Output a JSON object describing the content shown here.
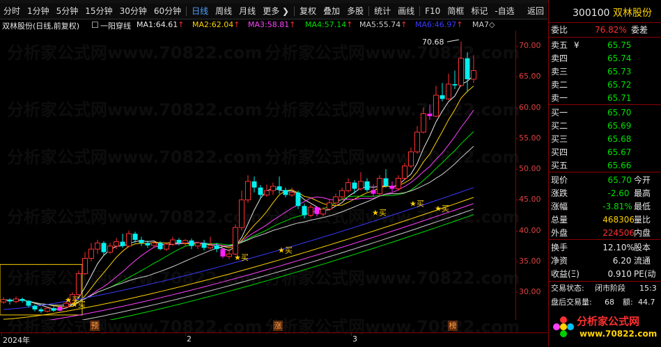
{
  "toolbar": {
    "items": [
      "分时",
      "1分钟",
      "5分钟",
      "15分钟",
      "30分钟",
      "60分钟",
      "日线",
      "周线",
      "月线",
      "更多 ❯",
      "复权",
      "叠加",
      "多股",
      "统计",
      "画线",
      "F10",
      "简框",
      "标记",
      "-自选"
    ],
    "active_index": 6,
    "back_label": "返回"
  },
  "header": {
    "stock": "双林股份",
    "mode": "(日线,前复权)",
    "indicator": "一阳穿线",
    "ma": [
      {
        "label": "MA1:",
        "value": "64.61",
        "color": "#e8e8e8"
      },
      {
        "label": "MA2:",
        "value": "62.04",
        "color": "#ffd200"
      },
      {
        "label": "MA3:",
        "value": "58.81",
        "color": "#ff40ff"
      },
      {
        "label": "MA4:",
        "value": "57.14",
        "color": "#00e000"
      },
      {
        "label": "MA5:",
        "value": "55.74",
        "color": "#cccccc"
      },
      {
        "label": "MA6:",
        "value": "46.97",
        "color": "#3a3aff"
      },
      {
        "label": "MA7",
        "value": "",
        "color": "#cccccc"
      }
    ],
    "arrow": "↑",
    "more_icon": "◇"
  },
  "chart_data": {
    "type": "candlestick",
    "y_ticks": [
      "70.00",
      "65.00",
      "60.00",
      "55.00",
      "50.00",
      "45.00",
      "40.00",
      "35.00",
      "30.00"
    ],
    "ylim": [
      25.5,
      72.5
    ],
    "x_labels": [
      "2024年",
      "2",
      "3"
    ],
    "peak_label": "70.68",
    "buy_label": "买",
    "bottom_markers": [
      "预",
      "涨",
      "榜"
    ],
    "candles": [
      [
        28.4,
        28.8,
        29.2,
        28.1
      ],
      [
        28.8,
        28.5,
        29.0,
        28.0
      ],
      [
        28.5,
        28.9,
        29.3,
        28.2
      ],
      [
        28.9,
        28.6,
        29.1,
        28.3
      ],
      [
        28.6,
        27.8,
        28.7,
        27.5
      ],
      [
        27.8,
        27.2,
        28.0,
        26.9
      ],
      [
        27.2,
        26.9,
        27.5,
        26.6
      ],
      [
        26.9,
        27.4,
        27.6,
        26.7
      ],
      [
        27.4,
        27.0,
        27.7,
        26.8
      ],
      [
        27.0,
        27.6,
        28.0,
        26.9
      ],
      [
        27.6,
        28.2,
        28.5,
        27.4
      ],
      [
        28.2,
        29.6,
        30.0,
        28.0
      ],
      [
        29.6,
        33.0,
        33.5,
        29.4
      ],
      [
        33.0,
        35.5,
        36.5,
        32.8
      ],
      [
        35.5,
        37.0,
        38.0,
        35.0
      ],
      [
        37.0,
        38.0,
        38.5,
        36.2
      ],
      [
        38.0,
        36.5,
        38.3,
        36.0
      ],
      [
        36.5,
        37.5,
        38.0,
        36.2
      ],
      [
        37.5,
        38.2,
        38.8,
        37.0
      ],
      [
        38.2,
        37.5,
        39.5,
        37.2
      ],
      [
        37.5,
        39.5,
        40.0,
        37.3
      ],
      [
        39.5,
        38.5,
        39.8,
        38.0
      ],
      [
        38.5,
        38.0,
        39.0,
        37.5
      ],
      [
        38.0,
        37.6,
        38.4,
        37.2
      ],
      [
        37.6,
        38.0,
        38.2,
        37.3
      ],
      [
        38.0,
        37.0,
        38.3,
        36.8
      ],
      [
        37.0,
        37.8,
        38.0,
        36.7
      ],
      [
        37.8,
        38.5,
        39.0,
        37.5
      ],
      [
        38.5,
        38.0,
        38.8,
        37.6
      ],
      [
        38.0,
        38.4,
        38.6,
        37.5
      ],
      [
        38.4,
        37.5,
        38.7,
        37.0
      ],
      [
        37.5,
        38.0,
        38.2,
        37.0
      ],
      [
        38.0,
        37.2,
        38.5,
        36.8
      ],
      [
        37.2,
        37.6,
        39.0,
        37.0
      ],
      [
        37.6,
        37.0,
        38.0,
        36.5
      ],
      [
        37.0,
        35.8,
        37.2,
        35.5
      ],
      [
        35.8,
        36.2,
        37.0,
        35.4
      ],
      [
        36.2,
        40.5,
        41.0,
        36.0
      ],
      [
        40.5,
        45.0,
        46.5,
        40.0
      ],
      [
        45.0,
        48.0,
        49.0,
        44.5
      ],
      [
        48.0,
        47.0,
        48.8,
        46.2
      ],
      [
        47.0,
        45.8,
        47.4,
        45.3
      ],
      [
        45.8,
        46.5,
        47.5,
        45.5
      ],
      [
        46.5,
        47.2,
        47.8,
        45.8
      ],
      [
        47.2,
        46.6,
        48.8,
        46.0
      ],
      [
        46.6,
        45.8,
        47.0,
        45.4
      ],
      [
        45.8,
        46.2,
        47.0,
        45.5
      ],
      [
        46.2,
        44.0,
        46.5,
        43.5
      ],
      [
        44.0,
        42.5,
        44.4,
        42.0
      ],
      [
        42.5,
        43.8,
        44.2,
        42.2
      ],
      [
        43.8,
        42.7,
        44.0,
        42.3
      ],
      [
        42.7,
        43.5,
        43.8,
        42.3
      ],
      [
        43.5,
        44.5,
        45.0,
        43.2
      ],
      [
        44.5,
        45.5,
        46.0,
        44.0
      ],
      [
        45.5,
        46.5,
        47.0,
        45.0
      ],
      [
        46.5,
        47.8,
        48.5,
        46.2
      ],
      [
        47.8,
        46.8,
        48.2,
        46.0
      ],
      [
        46.8,
        48.0,
        49.5,
        46.5
      ],
      [
        48.0,
        46.6,
        48.5,
        46.3
      ],
      [
        46.6,
        46.0,
        47.5,
        45.5
      ],
      [
        46.0,
        48.5,
        49.0,
        45.6
      ],
      [
        48.5,
        47.3,
        50.0,
        47.0
      ],
      [
        47.3,
        46.8,
        48.0,
        46.3
      ],
      [
        46.8,
        48.5,
        49.0,
        46.5
      ],
      [
        48.5,
        50.5,
        51.0,
        48.2
      ],
      [
        50.5,
        52.8,
        53.5,
        50.2
      ],
      [
        52.8,
        56.0,
        57.0,
        52.5
      ],
      [
        56.0,
        59.0,
        60.0,
        55.8
      ],
      [
        59.0,
        58.6,
        60.5,
        58.0
      ],
      [
        58.6,
        62.0,
        63.5,
        58.4
      ],
      [
        62.0,
        61.4,
        64.0,
        61.0
      ],
      [
        61.4,
        63.8,
        65.5,
        61.2
      ],
      [
        63.8,
        63.6,
        66.0,
        63.0
      ],
      [
        63.6,
        68.0,
        70.7,
        63.3
      ],
      [
        68.0,
        64.6,
        69.0,
        62.5
      ],
      [
        64.6,
        66.0,
        68.5,
        64.0
      ]
    ]
  },
  "quote": {
    "code": "300100",
    "name": "双林股份",
    "weibi_label": "委比",
    "weibi_value": "76.82%",
    "weicha_label": "委差",
    "asks": [
      {
        "label": "卖五",
        "value": "65.75",
        "mark": "¥"
      },
      {
        "label": "卖四",
        "value": "65.74",
        "mark": ""
      },
      {
        "label": "卖三",
        "value": "65.73",
        "mark": ""
      },
      {
        "label": "卖二",
        "value": "65.72",
        "mark": ""
      },
      {
        "label": "卖一",
        "value": "65.71",
        "mark": ""
      }
    ],
    "bids": [
      {
        "label": "买一",
        "value": "65.70"
      },
      {
        "label": "买二",
        "value": "65.69"
      },
      {
        "label": "买三",
        "value": "65.68"
      },
      {
        "label": "买四",
        "value": "65.67"
      },
      {
        "label": "买五",
        "value": "65.66"
      }
    ],
    "stats": [
      {
        "label": "现价",
        "value": "65.70",
        "value_color": "#00e000",
        "label2": "今开"
      },
      {
        "label": "涨跌",
        "value": "-2.60",
        "value_color": "#00e000",
        "label2": "最高"
      },
      {
        "label": "涨幅",
        "value": "-3.81%",
        "value_color": "#00e000",
        "label2": "最低"
      },
      {
        "label": "总量",
        "value": "468306",
        "value_color": "#ffd200",
        "label2": "量比"
      },
      {
        "label": "外盘",
        "value": "224506",
        "value_color": "#ff3030",
        "label2": "内盘"
      }
    ],
    "stats2": [
      {
        "label": "换手",
        "value": "12.10%",
        "label2": "股本"
      },
      {
        "label": "净资",
        "value": "6.20",
        "label2": "流通"
      },
      {
        "label": "收益(Ξ)",
        "value": "0.910",
        "label2": "PE(动"
      }
    ],
    "trade_status_label": "交易状态:",
    "trade_status_value": "闭市阶段",
    "trade_time": "15:3",
    "after_volume_label": "盘后交易量:",
    "after_volume_value": "68",
    "amount_label": "额:",
    "amount_value": "44.7"
  },
  "watermark": {
    "text": "分析家公式网www.70822.com",
    "logo_text": "分析家公式网",
    "logo_url": "www.70822.com"
  }
}
